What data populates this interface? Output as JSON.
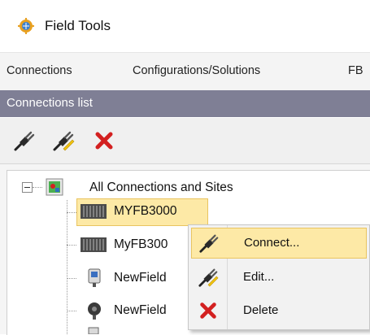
{
  "window": {
    "title": "Field Tools",
    "app_icon": "gear-globe-icon"
  },
  "menubar": {
    "items": [
      "Connections",
      "Configurations/Solutions",
      "FB"
    ]
  },
  "panel": {
    "header": "Connections list"
  },
  "toolbar": {
    "buttons": [
      {
        "icon": "plug-connect-icon"
      },
      {
        "icon": "plug-edit-icon"
      },
      {
        "icon": "delete-x-icon"
      }
    ]
  },
  "tree": {
    "root": {
      "label": "All Connections and Sites",
      "expander": "−"
    },
    "children": [
      {
        "label": "MYFB3000",
        "icon": "device-rack-icon",
        "selected": true
      },
      {
        "label": "MyFB300",
        "icon": "device-rack-icon"
      },
      {
        "label": "NewField",
        "icon": "device-meter-icon"
      },
      {
        "label": "NewField",
        "icon": "device-sensor-icon"
      }
    ]
  },
  "context_menu": {
    "items": [
      {
        "label": "Connect...",
        "icon": "plug-connect-icon",
        "hover": true
      },
      {
        "label": "Edit...",
        "icon": "plug-edit-icon"
      },
      {
        "label": "Delete",
        "icon": "delete-x-icon"
      }
    ]
  },
  "colors": {
    "panel_header": "#7f7f95",
    "selection": "#fde9a6",
    "selection_border": "#e9c460",
    "delete_red": "#d32020",
    "plug_yellow": "#f1c40f"
  }
}
